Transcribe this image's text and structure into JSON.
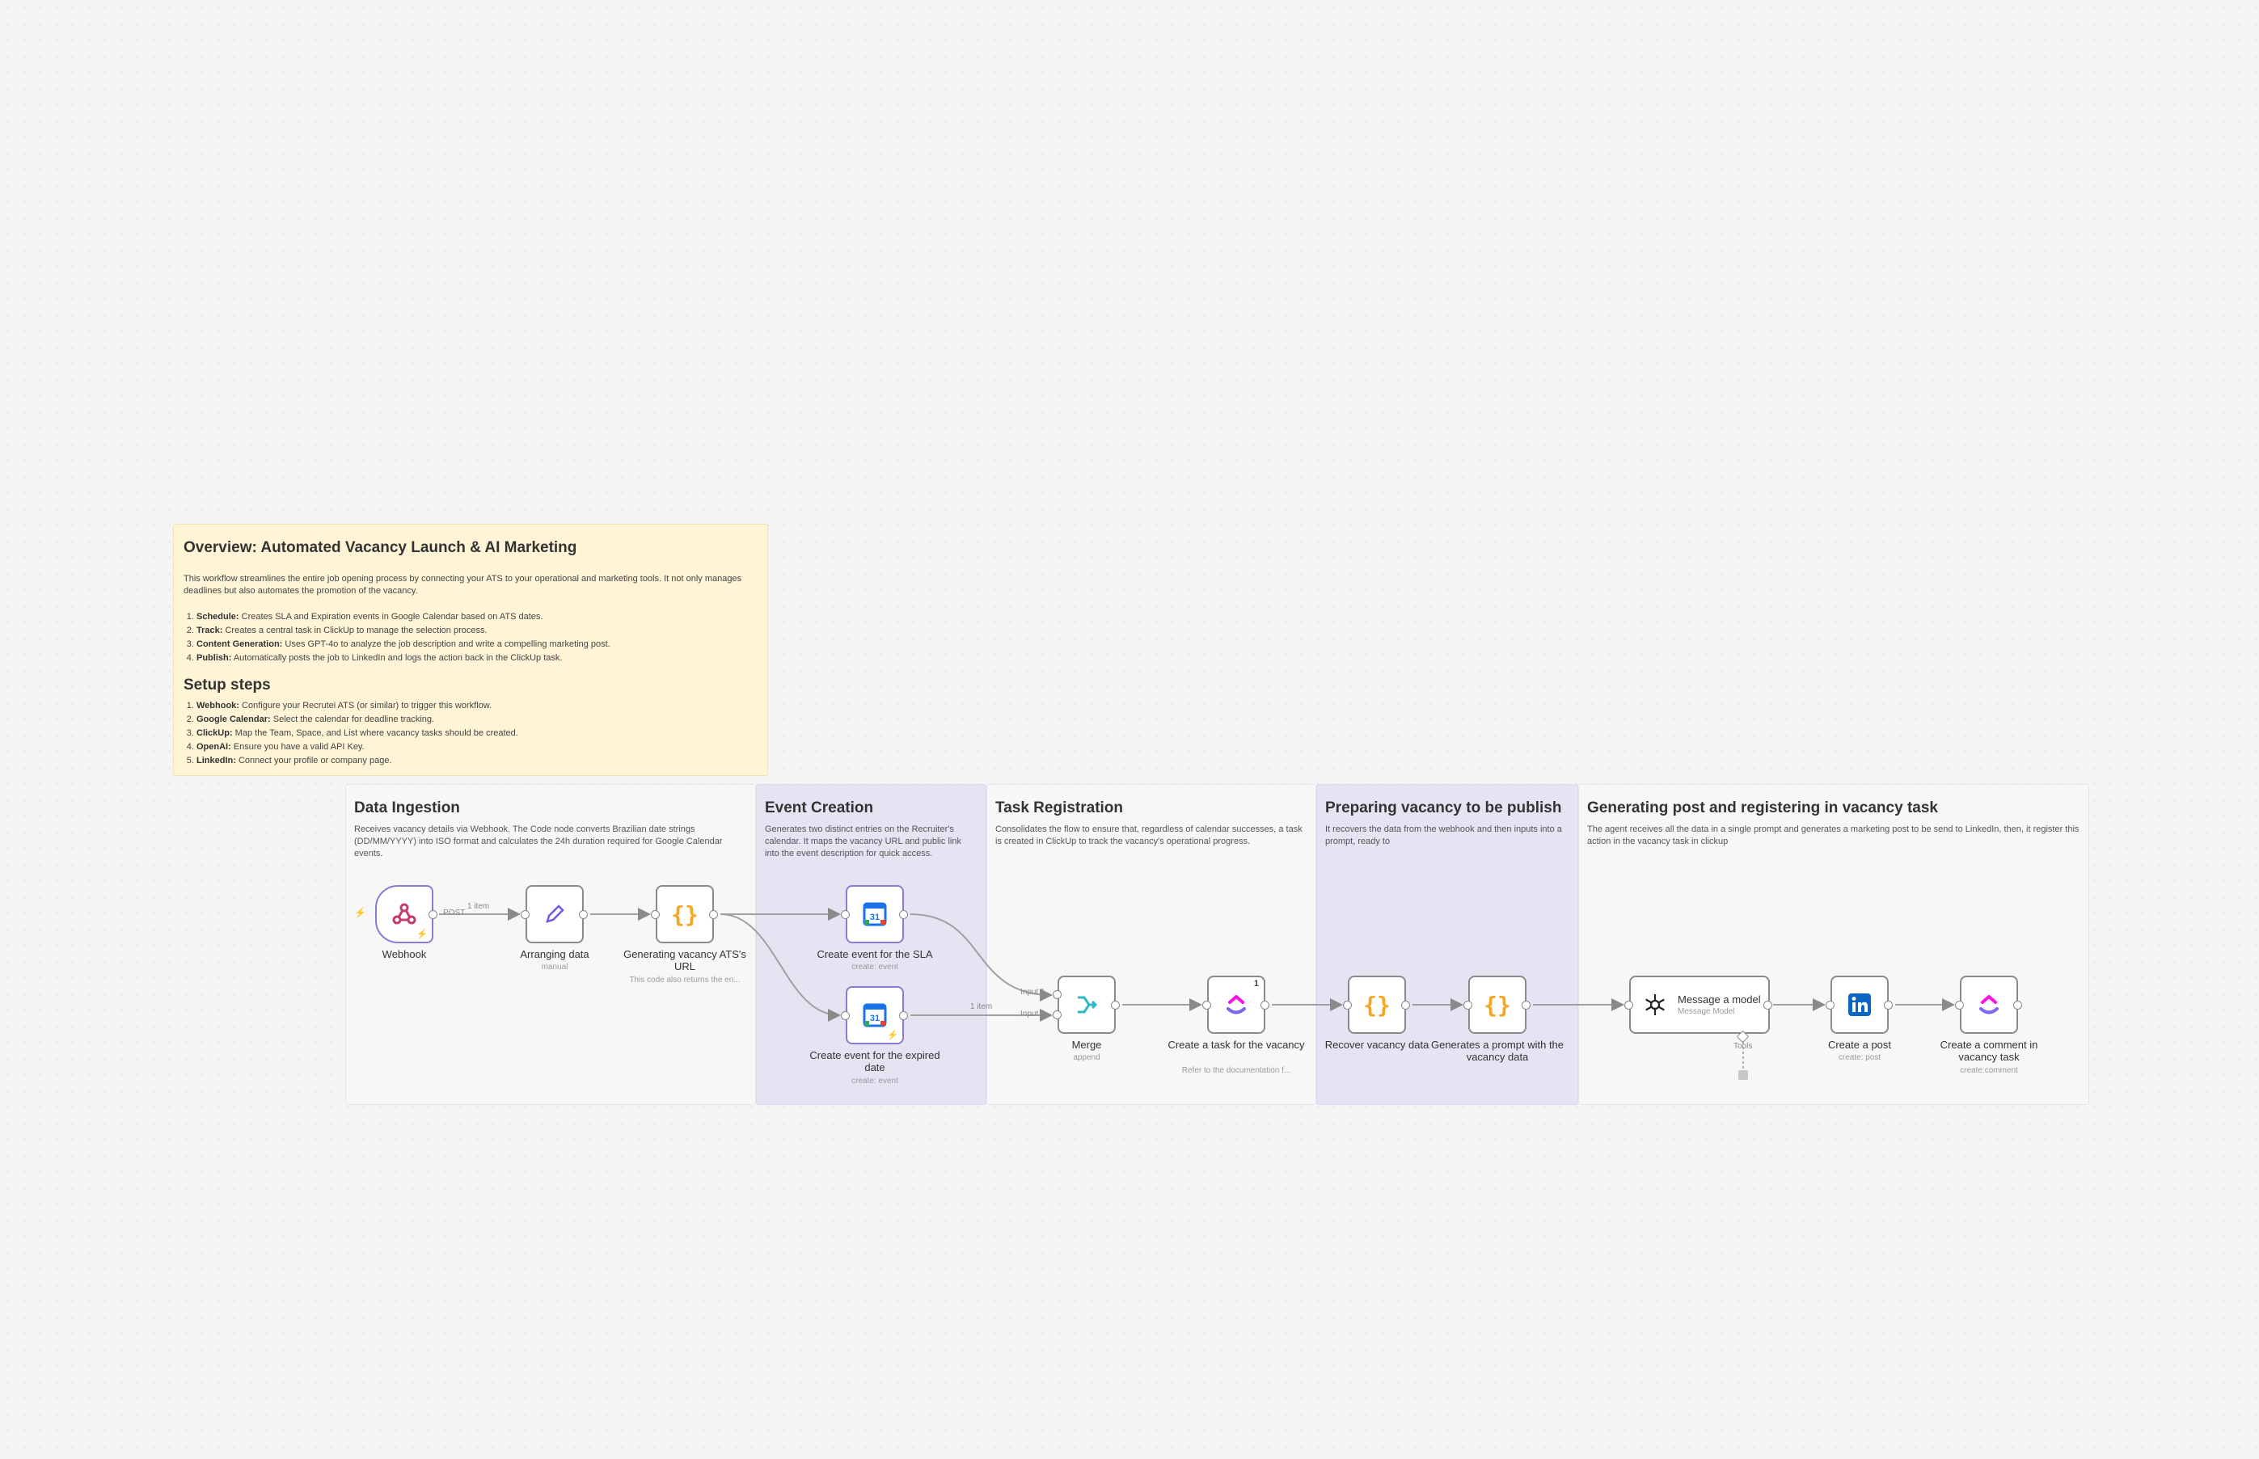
{
  "overview": {
    "title": "Overview: Automated Vacancy Launch & AI Marketing",
    "intro": "This workflow streamlines the entire job opening process by connecting your ATS to your operational and marketing tools. It not only manages deadlines but also automates the promotion of the vacancy.",
    "items": [
      {
        "label": "Schedule:",
        "text": " Creates SLA and Expiration events in Google Calendar based on ATS dates."
      },
      {
        "label": "Track:",
        "text": " Creates a central task in ClickUp to manage the selection process."
      },
      {
        "label": "Content Generation:",
        "text": " Uses GPT-4o to analyze the job description and write a compelling marketing post."
      },
      {
        "label": "Publish:",
        "text": " Automatically posts the job to LinkedIn and logs the action back in the ClickUp task."
      }
    ],
    "setup_title": "Setup steps",
    "setup_items": [
      {
        "label": "Webhook:",
        "text": " Configure your Recrutei ATS (or similar) to trigger this workflow."
      },
      {
        "label": "Google Calendar:",
        "text": " Select the calendar for deadline tracking."
      },
      {
        "label": "ClickUp:",
        "text": " Map the Team, Space, and List where vacancy tasks should be created."
      },
      {
        "label": "OpenAI:",
        "text": " Ensure you have a valid API Key."
      },
      {
        "label": "LinkedIn:",
        "text": " Connect your profile or company page."
      }
    ]
  },
  "sections": {
    "ingestion": {
      "title": "Data Ingestion",
      "desc": "Receives vacancy details via Webhook. The Code node converts Brazilian date strings (DD/MM/YYYY) into ISO format and calculates the 24h duration required for Google Calendar events."
    },
    "events": {
      "title": "Event Creation",
      "desc": "Generates two distinct entries on the Recruiter's calendar. It maps the vacancy URL and public link into the event description for quick access."
    },
    "task": {
      "title": "Task Registration",
      "desc": "Consolidates the flow to ensure that, regardless of calendar successes, a task is created in ClickUp to track the vacancy's operational progress."
    },
    "prep": {
      "title": "Preparing vacancy to be publish",
      "desc": "It recovers the data from the webhook and then inputs into a prompt, ready to"
    },
    "post": {
      "title": "Generating post and registering in vacancy task",
      "desc": "The agent receives all the data in a single prompt and generates a marketing post to be send to LinkedIn, then, it register this action in the vacancy task in clickup"
    }
  },
  "nodes": {
    "webhook": {
      "label": "Webhook",
      "icon": "webhook-icon"
    },
    "arranging": {
      "label": "Arranging data",
      "sub": "manual",
      "icon": "pencil-icon"
    },
    "generating_url": {
      "label": "Generating vacancy ATS's URL",
      "sub": "This code also returns the en...",
      "icon": "code-braces-icon"
    },
    "event_sla": {
      "label": "Create event for the SLA",
      "sub": "create: event",
      "icon": "google-calendar-icon"
    },
    "event_expired": {
      "label": "Create event for the expired date",
      "sub": "create: event",
      "icon": "google-calendar-icon"
    },
    "merge": {
      "label": "Merge",
      "sub": "append",
      "icon": "merge-icon"
    },
    "create_task": {
      "label": "Create a task for the vacancy",
      "sub": "Refer to the documentation f...",
      "badge": "1",
      "icon": "clickup-icon"
    },
    "recover": {
      "label": "Recover vacancy data",
      "icon": "code-braces-icon"
    },
    "prompt": {
      "label": "Generates a prompt with the vacancy data",
      "icon": "code-braces-icon"
    },
    "message_model": {
      "label": "Message a model",
      "sub": "Message Model",
      "icon": "openai-icon"
    },
    "create_post": {
      "label": "Create a post",
      "sub": "create: post",
      "icon": "linkedin-icon"
    },
    "create_comment": {
      "label": "Create a comment in vacancy task",
      "sub": "create:comment",
      "icon": "clickup-icon"
    }
  },
  "edges": {
    "post_label": "POST",
    "item1": "1 item",
    "item2": "1 item",
    "input1": "Input 1",
    "input2": "Input 2",
    "tools": "Tools"
  },
  "colors": {
    "overview_bg": "#fff4d6",
    "purple_section": "#e6e3f3",
    "code_orange": "#f5a623",
    "merge_teal": "#2cb8c6",
    "linkedin_blue": "#0a66c2",
    "trigger_border": "#8a7ad8"
  }
}
